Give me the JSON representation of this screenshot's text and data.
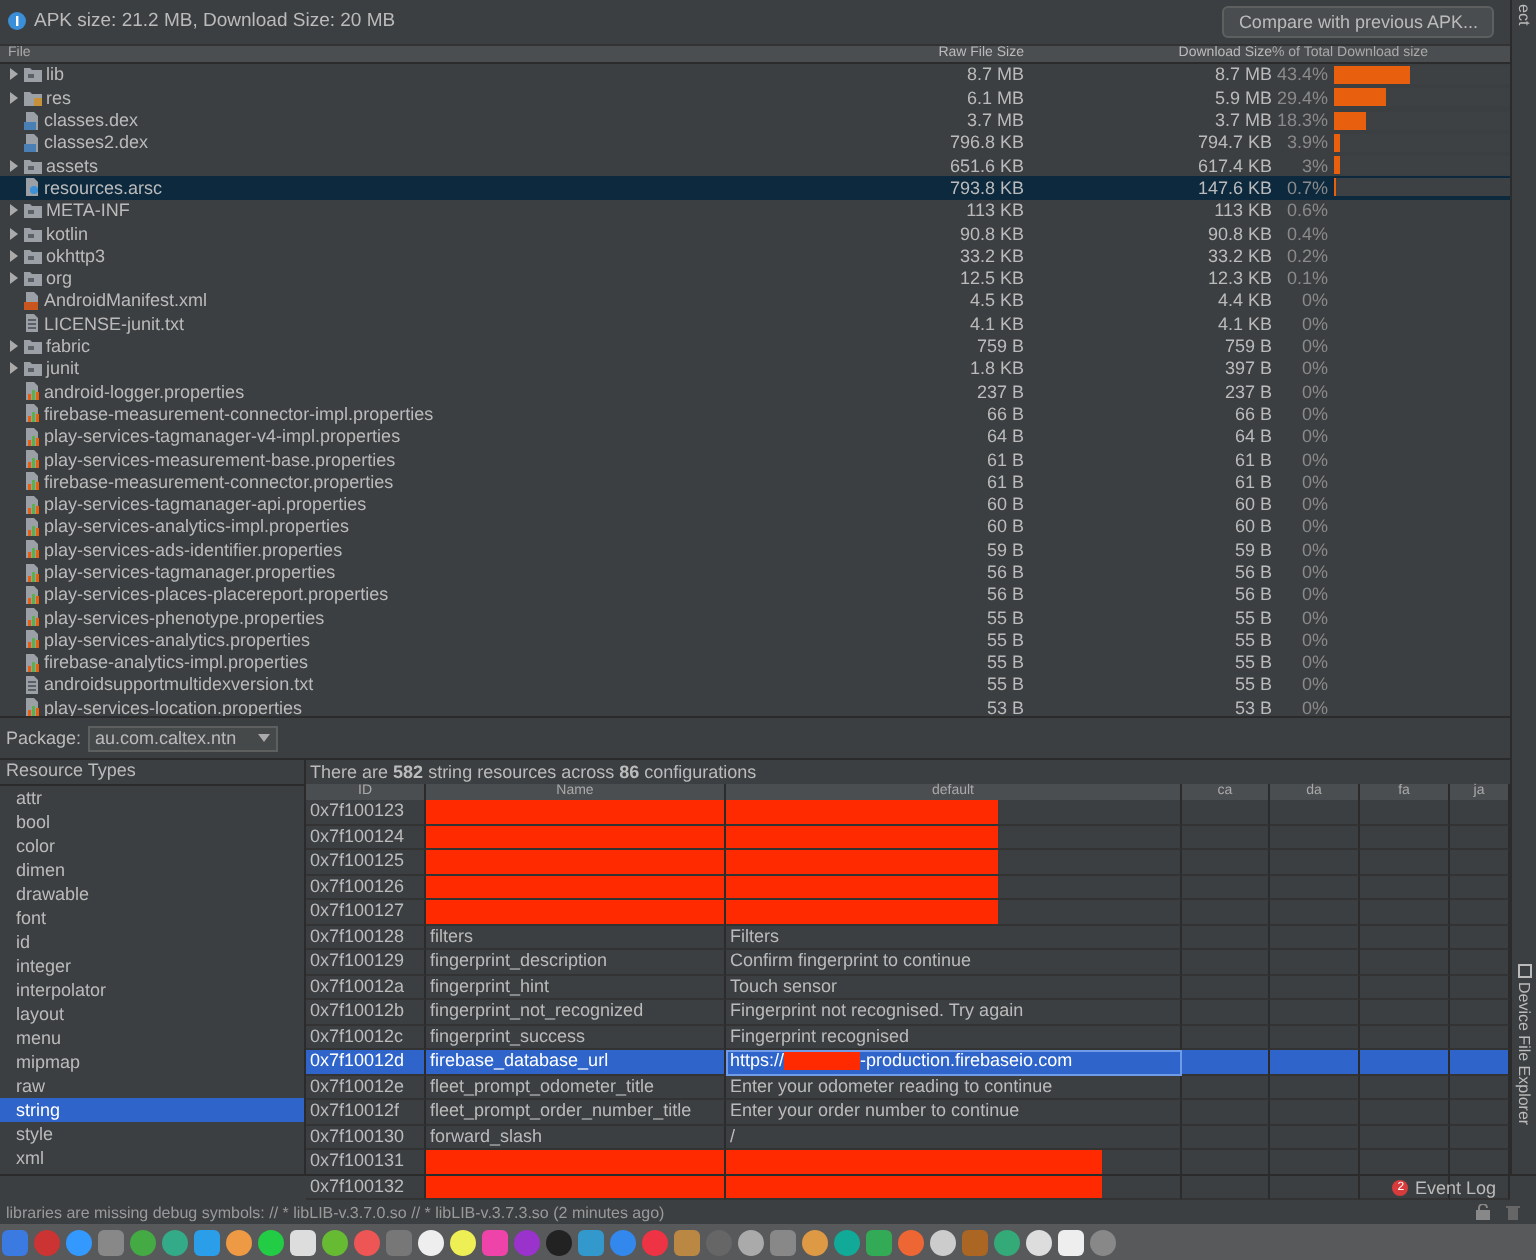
{
  "info_bar": {
    "text": "APK size: 21.2 MB, Download Size: 20 MB",
    "compare_button": "Compare with previous APK..."
  },
  "side_strip": {
    "top_label": "ect",
    "tool_window": "Device File Explorer"
  },
  "file_table": {
    "columns": [
      "File",
      "Raw File Size",
      "Download Size",
      "% of Total Download size"
    ],
    "rows": [
      {
        "name": "lib",
        "kind": "folder",
        "expandable": true,
        "selected": false,
        "raw": "8.7 MB",
        "download": "8.7 MB",
        "percent": "43.4%",
        "level": 0.434
      },
      {
        "name": "res",
        "kind": "res",
        "expandable": true,
        "selected": false,
        "raw": "6.1 MB",
        "download": "5.9 MB",
        "percent": "29.4%",
        "level": 0.294
      },
      {
        "name": "classes.dex",
        "kind": "dex",
        "expandable": false,
        "selected": false,
        "raw": "3.7 MB",
        "download": "3.7 MB",
        "percent": "18.3%",
        "level": 0.183
      },
      {
        "name": "classes2.dex",
        "kind": "dex",
        "expandable": false,
        "selected": false,
        "raw": "796.8 KB",
        "download": "794.7 KB",
        "percent": "3.9%",
        "level": 0.039
      },
      {
        "name": "assets",
        "kind": "folder",
        "expandable": true,
        "selected": false,
        "raw": "651.6 KB",
        "download": "617.4 KB",
        "percent": "3%",
        "level": 0.03
      },
      {
        "name": "resources.arsc",
        "kind": "arsc",
        "expandable": false,
        "selected": true,
        "raw": "793.8 KB",
        "download": "147.6 KB",
        "percent": "0.7%",
        "level": 0.007
      },
      {
        "name": "META-INF",
        "kind": "folder",
        "expandable": true,
        "selected": false,
        "raw": "113 KB",
        "download": "113 KB",
        "percent": "0.6%"
      },
      {
        "name": "kotlin",
        "kind": "folder",
        "expandable": true,
        "selected": false,
        "raw": "90.8 KB",
        "download": "90.8 KB",
        "percent": "0.4%"
      },
      {
        "name": "okhttp3",
        "kind": "folder",
        "expandable": true,
        "selected": false,
        "raw": "33.2 KB",
        "download": "33.2 KB",
        "percent": "0.2%"
      },
      {
        "name": "org",
        "kind": "folder",
        "expandable": true,
        "selected": false,
        "raw": "12.5 KB",
        "download": "12.3 KB",
        "percent": "0.1%"
      },
      {
        "name": "AndroidManifest.xml",
        "kind": "xml",
        "expandable": false,
        "selected": false,
        "raw": "4.5 KB",
        "download": "4.4 KB",
        "percent": "0%"
      },
      {
        "name": "LICENSE-junit.txt",
        "kind": "txt",
        "expandable": false,
        "selected": false,
        "raw": "4.1 KB",
        "download": "4.1 KB",
        "percent": "0%"
      },
      {
        "name": "fabric",
        "kind": "folder",
        "expandable": true,
        "selected": false,
        "raw": "759 B",
        "download": "759 B",
        "percent": "0%"
      },
      {
        "name": "junit",
        "kind": "folder",
        "expandable": true,
        "selected": false,
        "raw": "1.8 KB",
        "download": "397 B",
        "percent": "0%"
      },
      {
        "name": "android-logger.properties",
        "kind": "properties",
        "expandable": false,
        "selected": false,
        "raw": "237 B",
        "download": "237 B",
        "percent": "0%"
      },
      {
        "name": "firebase-measurement-connector-impl.properties",
        "kind": "properties",
        "expandable": false,
        "selected": false,
        "raw": "66 B",
        "download": "66 B",
        "percent": "0%"
      },
      {
        "name": "play-services-tagmanager-v4-impl.properties",
        "kind": "properties",
        "expandable": false,
        "selected": false,
        "raw": "64 B",
        "download": "64 B",
        "percent": "0%"
      },
      {
        "name": "play-services-measurement-base.properties",
        "kind": "properties",
        "expandable": false,
        "selected": false,
        "raw": "61 B",
        "download": "61 B",
        "percent": "0%"
      },
      {
        "name": "firebase-measurement-connector.properties",
        "kind": "properties",
        "expandable": false,
        "selected": false,
        "raw": "61 B",
        "download": "61 B",
        "percent": "0%"
      },
      {
        "name": "play-services-tagmanager-api.properties",
        "kind": "properties",
        "expandable": false,
        "selected": false,
        "raw": "60 B",
        "download": "60 B",
        "percent": "0%"
      },
      {
        "name": "play-services-analytics-impl.properties",
        "kind": "properties",
        "expandable": false,
        "selected": false,
        "raw": "60 B",
        "download": "60 B",
        "percent": "0%"
      },
      {
        "name": "play-services-ads-identifier.properties",
        "kind": "properties",
        "expandable": false,
        "selected": false,
        "raw": "59 B",
        "download": "59 B",
        "percent": "0%"
      },
      {
        "name": "play-services-tagmanager.properties",
        "kind": "properties",
        "expandable": false,
        "selected": false,
        "raw": "56 B",
        "download": "56 B",
        "percent": "0%"
      },
      {
        "name": "play-services-places-placereport.properties",
        "kind": "properties",
        "expandable": false,
        "selected": false,
        "raw": "56 B",
        "download": "56 B",
        "percent": "0%"
      },
      {
        "name": "play-services-phenotype.properties",
        "kind": "properties",
        "expandable": false,
        "selected": false,
        "raw": "55 B",
        "download": "55 B",
        "percent": "0%"
      },
      {
        "name": "play-services-analytics.properties",
        "kind": "properties",
        "expandable": false,
        "selected": false,
        "raw": "55 B",
        "download": "55 B",
        "percent": "0%"
      },
      {
        "name": "firebase-analytics-impl.properties",
        "kind": "properties",
        "expandable": false,
        "selected": false,
        "raw": "55 B",
        "download": "55 B",
        "percent": "0%"
      },
      {
        "name": "androidsupportmultidexversion.txt",
        "kind": "txt",
        "expandable": false,
        "selected": false,
        "raw": "55 B",
        "download": "55 B",
        "percent": "0%"
      },
      {
        "name": "play-services-location.properties",
        "kind": "properties",
        "expandable": false,
        "selected": false,
        "raw": "53 B",
        "download": "53 B",
        "percent": "0%"
      }
    ]
  },
  "package": {
    "label": "Package:",
    "value": "au.com.caltex.ntn"
  },
  "resource_types": {
    "title": "Resource Types",
    "items": [
      {
        "label": "attr",
        "selected": false
      },
      {
        "label": "bool",
        "selected": false
      },
      {
        "label": "color",
        "selected": false
      },
      {
        "label": "dimen",
        "selected": false
      },
      {
        "label": "drawable",
        "selected": false
      },
      {
        "label": "font",
        "selected": false
      },
      {
        "label": "id",
        "selected": false
      },
      {
        "label": "integer",
        "selected": false
      },
      {
        "label": "interpolator",
        "selected": false
      },
      {
        "label": "layout",
        "selected": false
      },
      {
        "label": "menu",
        "selected": false
      },
      {
        "label": "mipmap",
        "selected": false
      },
      {
        "label": "raw",
        "selected": false
      },
      {
        "label": "string",
        "selected": true
      },
      {
        "label": "style",
        "selected": false
      },
      {
        "label": "xml",
        "selected": false
      }
    ]
  },
  "resources": {
    "summary": "There are **582** string resources across **86** configurations",
    "columns": [
      "ID",
      "Name",
      "default",
      "ca",
      "da",
      "fa",
      "ja"
    ],
    "rows": [
      {
        "id": "0x7f100123",
        "redacted": true,
        "selected": false
      },
      {
        "id": "0x7f100124",
        "redacted": true,
        "selected": false
      },
      {
        "id": "0x7f100125",
        "redacted": true,
        "selected": false
      },
      {
        "id": "0x7f100126",
        "redacted": true,
        "selected": false
      },
      {
        "id": "0x7f100127",
        "redacted": true,
        "selected": false
      },
      {
        "id": "0x7f100128",
        "name": "filters",
        "default": "Filters",
        "redacted": false,
        "selected": false
      },
      {
        "id": "0x7f100129",
        "name": "fingerprint_description",
        "default": "Confirm fingerprint to continue",
        "redacted": false,
        "selected": false
      },
      {
        "id": "0x7f10012a",
        "name": "fingerprint_hint",
        "default": "Touch sensor",
        "redacted": false,
        "selected": false
      },
      {
        "id": "0x7f10012b",
        "name": "fingerprint_not_recognized",
        "default": "Fingerprint not recognised. Try again",
        "redacted": false,
        "selected": false
      },
      {
        "id": "0x7f10012c",
        "name": "fingerprint_success",
        "default": "Fingerprint recognised",
        "redacted": false,
        "selected": false
      },
      {
        "id": "0x7f10012d",
        "name": "firebase_database_url",
        "default": [
          "https://",
          "-production.firebaseio.com"
        ],
        "redacted": false,
        "selected": true
      },
      {
        "id": "0x7f10012e",
        "name": "fleet_prompt_odometer_title",
        "default": "Enter your odometer reading to continue",
        "redacted": false,
        "selected": false
      },
      {
        "id": "0x7f10012f",
        "name": "fleet_prompt_order_number_title",
        "default": "Enter your order number to continue",
        "redacted": false,
        "selected": false
      },
      {
        "id": "0x7f100130",
        "name": "forward_slash",
        "default": "/",
        "redacted": false,
        "selected": false
      },
      {
        "id": "0x7f100131",
        "redacted": true,
        "selected": false
      },
      {
        "id": "0x7f100132",
        "redacted": true,
        "selected": false
      }
    ]
  },
  "event_log": {
    "label": "Event Log",
    "count": "2"
  },
  "status": "libraries are missing debug symbols: // * libLIB-v.3.7.0.so // * libLIB-v.3.7.3.so (2 minutes ago)"
}
